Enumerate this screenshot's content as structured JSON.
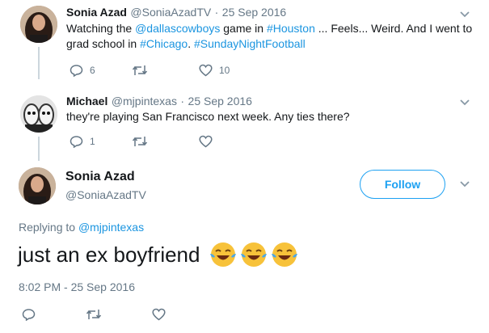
{
  "tweet1": {
    "name": "Sonia Azad",
    "handle": "@SoniaAzadTV",
    "sep": "·",
    "date": "25 Sep 2016",
    "text_parts": {
      "p1": "Watching the ",
      "mention": "@dallascowboys",
      "p2": " game in ",
      "tag_houston": "#Houston",
      "p3": " ... Feels... Weird. And I went to",
      "p4": "grad school in ",
      "tag_chicago": "#Chicago",
      "p5": ". ",
      "tag_snf": "#SundayNightFootball"
    },
    "reply_count": "6",
    "retweet_count": "",
    "like_count": "10"
  },
  "tweet2": {
    "name": "Michael",
    "handle": "@mjpintexas",
    "sep": "·",
    "date": "25 Sep 2016",
    "text": "they're playing San Francisco next week. Any ties there?",
    "reply_count": "1",
    "retweet_count": "",
    "like_count": ""
  },
  "main": {
    "name": "Sonia Azad",
    "handle": "@SoniaAzadTV",
    "follow_label": "Follow",
    "replying_prefix": "Replying to ",
    "replying_handle": "@mjpintexas",
    "text": "just an ex boyfriend",
    "emoji": [
      "face-with-tears-of-joy",
      "face-with-tears-of-joy",
      "face-with-tears-of-joy"
    ],
    "timestamp": "8:02 PM - 25 Sep 2016"
  },
  "colors": {
    "link": "#1b95e0",
    "follow": "#1da1f2",
    "muted": "#657786"
  }
}
